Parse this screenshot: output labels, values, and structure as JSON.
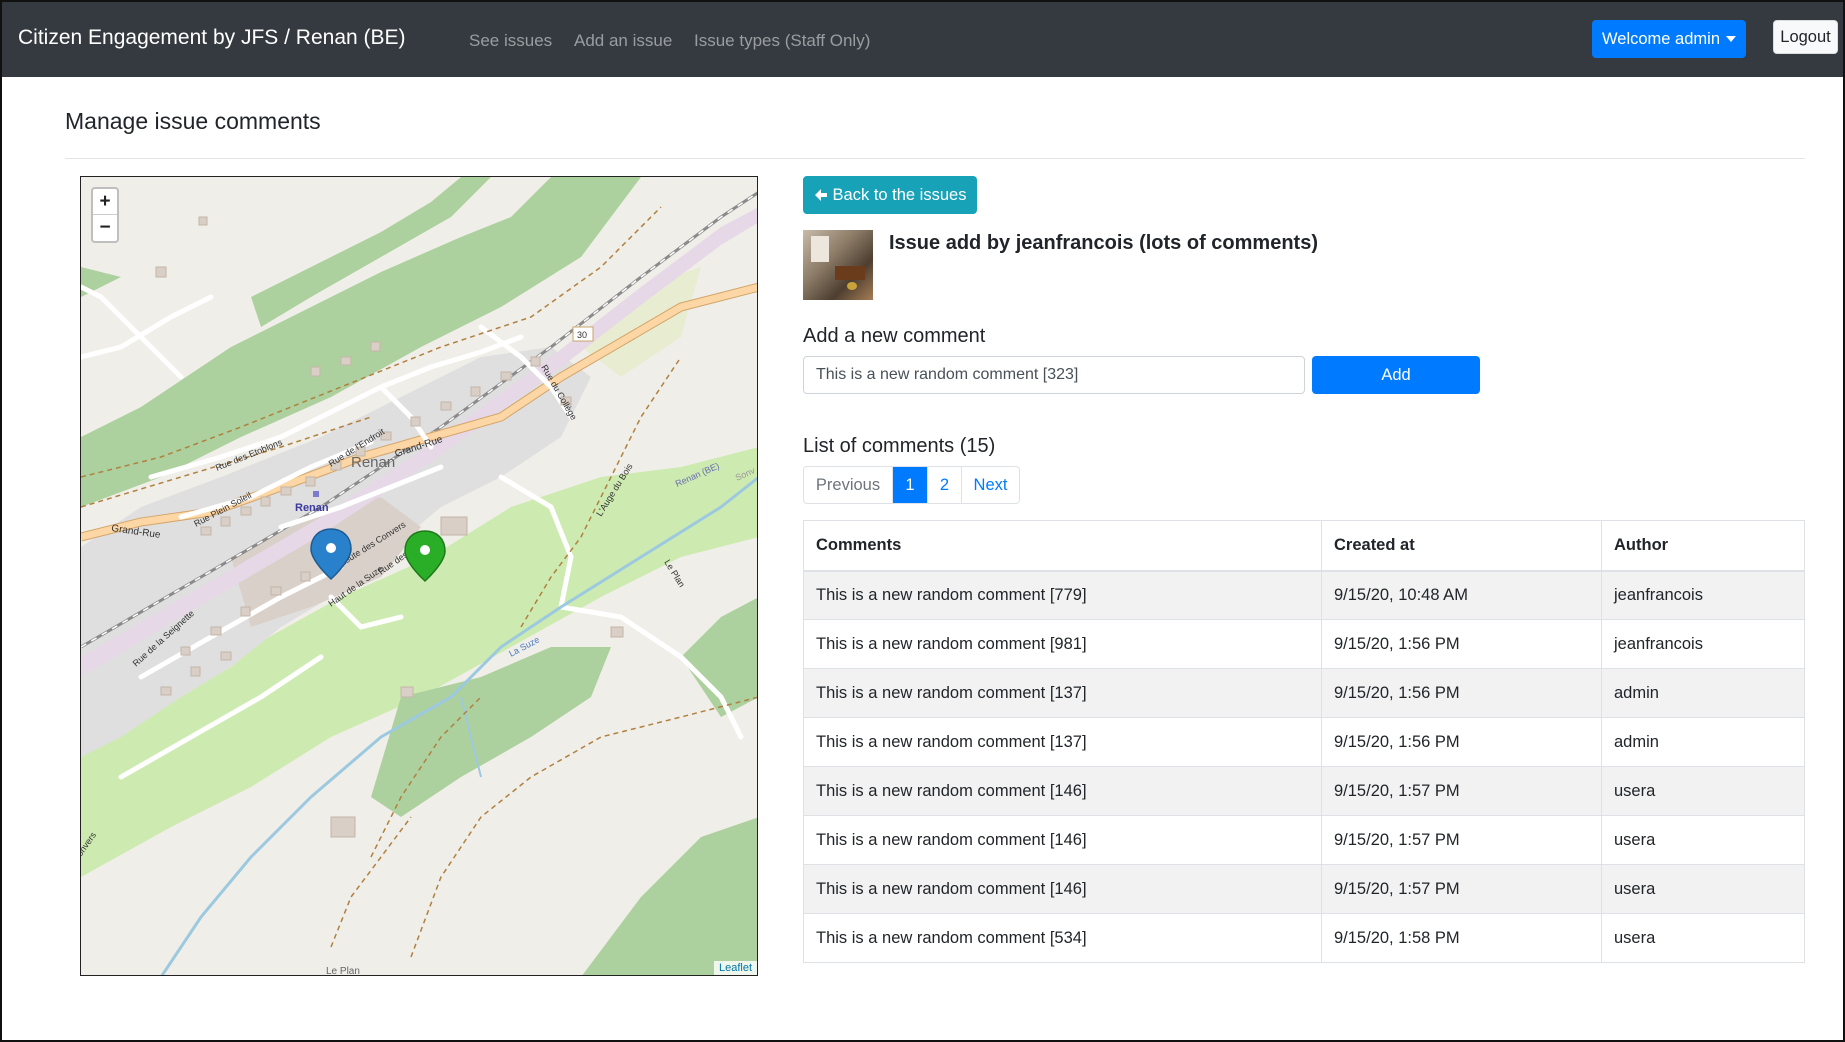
{
  "navbar": {
    "brand": "Citizen Engagement by JFS / Renan (BE)",
    "links": [
      "See issues",
      "Add an issue",
      "Issue types (Staff Only)"
    ],
    "welcome": "Welcome admin",
    "logout": "Logout"
  },
  "page": {
    "title": "Manage issue comments"
  },
  "map": {
    "zoom_in": "+",
    "zoom_out": "−",
    "attribution": "Leaflet",
    "labels": {
      "town": "Renan",
      "station": "Renan",
      "grand_rue_w": "Grand-Rue",
      "grand_rue_e": "Grand-Rue",
      "route30": "30",
      "etoblons": "Rue des Etoblons",
      "endroit": "Rue de l'Endroit",
      "plein_soleil": "Rue Plein Soleil",
      "college": "Rue du Collège",
      "convers": "Route des Convers",
      "haut_suze": "Haut de la Suze",
      "seignette": "Rue de la Seignette",
      "auge": "L'Auge du Bois",
      "le_plan": "Le Plan",
      "renan_be": "Renan (BE)",
      "suze": "La Suze",
      "le_plan_s": "Le Plan",
      "convers_w": "onvers",
      "sonv": "Sonv",
      "rue_des": "Rue des"
    },
    "marker_colors": {
      "blue": "#2a81cb",
      "green": "#2aad27"
    }
  },
  "issue": {
    "back_label": "Back to the issues",
    "title": "Issue add by jeanfrancois (lots of comments)"
  },
  "comment_form": {
    "label": "Add a new comment",
    "value": "This is a new random comment [323]",
    "add_label": "Add"
  },
  "comments": {
    "heading": "List of comments (15)",
    "pagination": {
      "previous": "Previous",
      "pages": [
        "1",
        "2"
      ],
      "next": "Next",
      "current": "1"
    },
    "columns": [
      "Comments",
      "Created at",
      "Author"
    ],
    "rows": [
      [
        "This is a new random comment [779]",
        "9/15/20, 10:48 AM",
        "jeanfrancois"
      ],
      [
        "This is a new random comment [981]",
        "9/15/20, 1:56 PM",
        "jeanfrancois"
      ],
      [
        "This is a new random comment [137]",
        "9/15/20, 1:56 PM",
        "admin"
      ],
      [
        "This is a new random comment [137]",
        "9/15/20, 1:56 PM",
        "admin"
      ],
      [
        "This is a new random comment [146]",
        "9/15/20, 1:57 PM",
        "usera"
      ],
      [
        "This is a new random comment [146]",
        "9/15/20, 1:57 PM",
        "usera"
      ],
      [
        "This is a new random comment [146]",
        "9/15/20, 1:57 PM",
        "usera"
      ],
      [
        "This is a new random comment [534]",
        "9/15/20, 1:58 PM",
        "usera"
      ]
    ]
  },
  "colors": {
    "navbar": "#343a40",
    "primary": "#007bff",
    "info": "#17a2b8"
  }
}
